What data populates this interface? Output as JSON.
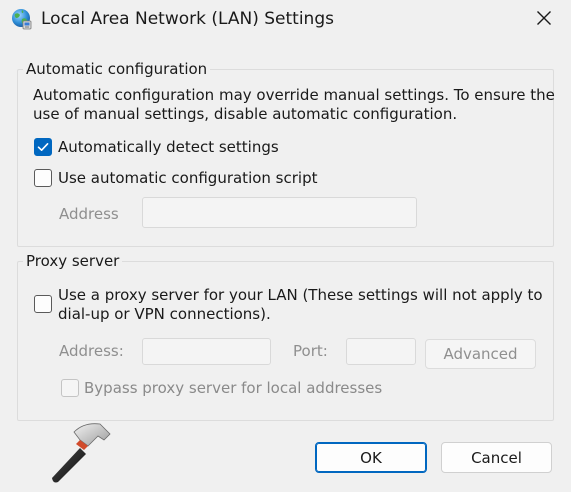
{
  "window": {
    "title": "Local Area Network (LAN) Settings",
    "title_icon": "globe-network-icon",
    "close_icon": "close-icon"
  },
  "auto_config": {
    "legend": "Automatic configuration",
    "description_line1": "Automatic configuration may override manual settings.  To ensure the",
    "description_line2": "use of manual settings, disable automatic configuration.",
    "auto_detect": {
      "label": "Automatically detect settings",
      "checked": true
    },
    "use_script": {
      "label": "Use automatic configuration script",
      "checked": false
    },
    "address_label": "Address",
    "address_value": ""
  },
  "proxy": {
    "legend": "Proxy server",
    "use_proxy": {
      "label_line1": "Use a proxy server for your LAN (These settings will not apply to",
      "label_line2": "dial-up or VPN connections).",
      "checked": false
    },
    "address_label": "Address:",
    "address_value": "",
    "port_label": "Port:",
    "port_value": "",
    "advanced_label": "Advanced",
    "bypass": {
      "label": "Bypass proxy server for local addresses",
      "checked": false,
      "enabled": false
    }
  },
  "buttons": {
    "ok_label": "OK",
    "cancel_label": "Cancel"
  },
  "watermark": {
    "icon": "hammer-logo-icon"
  },
  "colors": {
    "accent": "#0067c0",
    "background": "#f0f0f0",
    "disabled_text": "#8f8f8f"
  }
}
